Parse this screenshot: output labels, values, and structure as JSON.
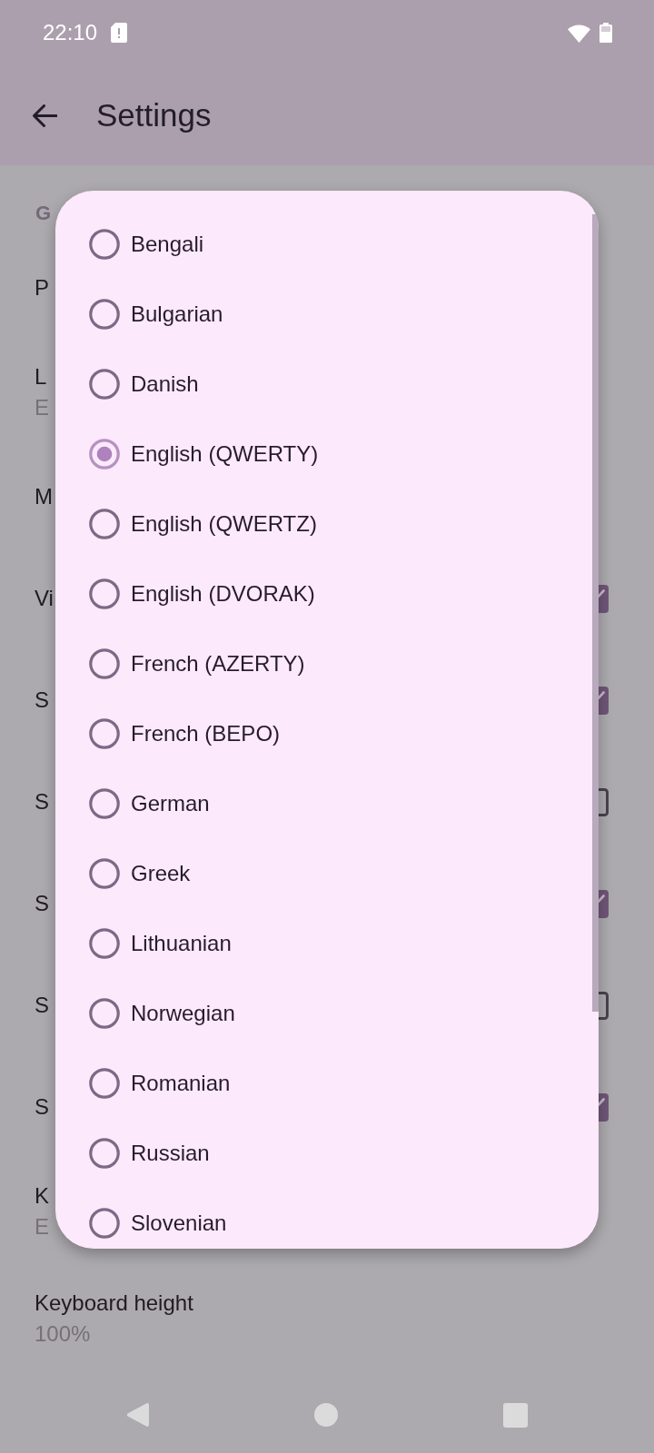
{
  "status_bar": {
    "time": "22:10"
  },
  "app_bar": {
    "title": "Settings"
  },
  "settings": {
    "section_header": "G",
    "items": [
      {
        "kind": "text",
        "title": "P"
      },
      {
        "kind": "text",
        "title": "L",
        "summary": "E"
      },
      {
        "kind": "text",
        "title": "M"
      },
      {
        "kind": "checkbox",
        "title": "Vi",
        "checked": true
      },
      {
        "kind": "checkbox",
        "title": "S",
        "checked": true
      },
      {
        "kind": "checkbox",
        "title": "S",
        "checked": false
      },
      {
        "kind": "checkbox",
        "title": "S",
        "checked": true
      },
      {
        "kind": "checkbox",
        "title": "S",
        "checked": false
      },
      {
        "kind": "checkbox",
        "title": "S",
        "checked": true
      },
      {
        "kind": "text",
        "title": "K",
        "summary": "E"
      },
      {
        "kind": "text",
        "title": "Keyboard height",
        "summary": "100%"
      }
    ]
  },
  "dialog": {
    "options": [
      {
        "label": "Bengali",
        "selected": false
      },
      {
        "label": "Bulgarian",
        "selected": false
      },
      {
        "label": "Danish",
        "selected": false
      },
      {
        "label": "English (QWERTY)",
        "selected": true
      },
      {
        "label": "English (QWERTZ)",
        "selected": false
      },
      {
        "label": "English (DVORAK)",
        "selected": false
      },
      {
        "label": "French (AZERTY)",
        "selected": false
      },
      {
        "label": "French (BEPO)",
        "selected": false
      },
      {
        "label": "German",
        "selected": false
      },
      {
        "label": "Greek",
        "selected": false
      },
      {
        "label": "Lithuanian",
        "selected": false
      },
      {
        "label": "Norwegian",
        "selected": false
      },
      {
        "label": "Romanian",
        "selected": false
      },
      {
        "label": "Russian",
        "selected": false
      },
      {
        "label": "Slovenian",
        "selected": false
      }
    ]
  }
}
